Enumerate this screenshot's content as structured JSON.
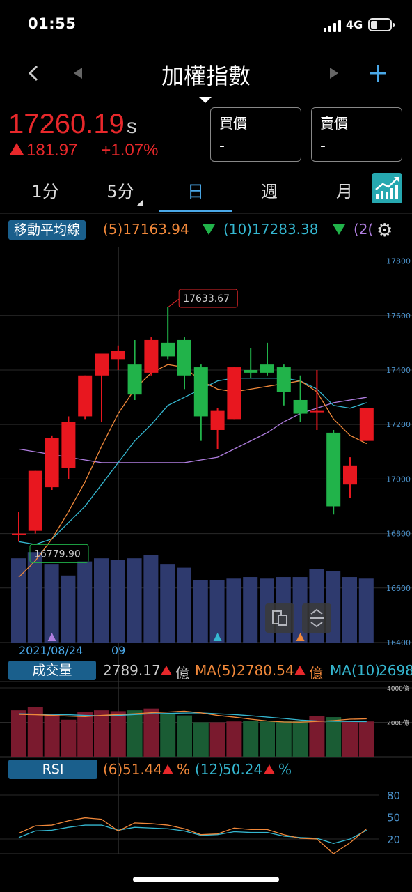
{
  "status": {
    "time": "01:55",
    "network": "4G"
  },
  "nav": {
    "title": "加權指數",
    "back": "‹",
    "add": "+"
  },
  "quote": {
    "price": "17260.19",
    "price_suffix": "s",
    "change": "181.97",
    "change_pct": "+1.07%",
    "bid_label": "買價",
    "bid_value": "-",
    "ask_label": "賣價",
    "ask_value": "-",
    "color_up": "#e8282b"
  },
  "tabs": [
    "1分",
    "5分",
    "日",
    "週",
    "月"
  ],
  "active_tab": "日",
  "ma_legend": {
    "label": "移動平均線",
    "ma5": "(5)17163.94",
    "ma10": "(10)17283.38",
    "ma20": "(2("
  },
  "price_axis": [
    "17800",
    "17600",
    "17400",
    "17200",
    "17000",
    "16800",
    "16600",
    "16400"
  ],
  "annotations": {
    "high": "17633.67",
    "low": "16779.90"
  },
  "date_labels": {
    "first": "2021/08/24",
    "second": "09"
  },
  "volume_legend": {
    "label": "成交量",
    "value": "2789.17",
    "unit": "億",
    "ma5_label": "MA(5)",
    "ma5": "2780.54",
    "ma5_unit": "億",
    "ma10_label": "MA(10)",
    "ma10": "2698"
  },
  "volume_axis": [
    "4000億",
    "2000億"
  ],
  "rsi_legend": {
    "label": "RSI",
    "rsi6_label": "(6)",
    "rsi6": "51.44",
    "rsi12_label": "(12)",
    "rsi12": "50.24",
    "unit": "%"
  },
  "rsi_axis": [
    "80",
    "50",
    "20"
  ],
  "colors": {
    "up": "#e8171f",
    "down": "#21b34a",
    "ma5": "#f0883a",
    "ma10": "#35b7d0",
    "ma20": "#b07ee0",
    "volbar": "#2e3a6e",
    "accent": "#4aa8e8"
  },
  "chart_data": {
    "type": "candlestick",
    "ylim": [
      16400,
      17850
    ],
    "candles": [
      {
        "o": 16800,
        "h": 16880,
        "l": 16770,
        "c": 16800
      },
      {
        "o": 16810,
        "h": 17030,
        "l": 16800,
        "c": 17030
      },
      {
        "o": 16970,
        "h": 17160,
        "l": 16960,
        "c": 17150
      },
      {
        "o": 17040,
        "h": 17230,
        "l": 17000,
        "c": 17210
      },
      {
        "o": 17230,
        "h": 17380,
        "l": 17220,
        "c": 17380
      },
      {
        "o": 17380,
        "h": 17460,
        "l": 17210,
        "c": 17460
      },
      {
        "o": 17440,
        "h": 17490,
        "l": 17400,
        "c": 17470
      },
      {
        "o": 17420,
        "h": 17510,
        "l": 17290,
        "c": 17310
      },
      {
        "o": 17390,
        "h": 17520,
        "l": 17380,
        "c": 17510
      },
      {
        "o": 17500,
        "h": 17630,
        "l": 17440,
        "c": 17450
      },
      {
        "o": 17510,
        "h": 17520,
        "l": 17330,
        "c": 17380
      },
      {
        "o": 17410,
        "h": 17420,
        "l": 17140,
        "c": 17230
      },
      {
        "o": 17180,
        "h": 17260,
        "l": 17110,
        "c": 17250
      },
      {
        "o": 17220,
        "h": 17410,
        "l": 17220,
        "c": 17410
      },
      {
        "o": 17400,
        "h": 17480,
        "l": 17370,
        "c": 17390
      },
      {
        "o": 17420,
        "h": 17500,
        "l": 17380,
        "c": 17390
      },
      {
        "o": 17410,
        "h": 17420,
        "l": 17270,
        "c": 17320
      },
      {
        "o": 17290,
        "h": 17380,
        "l": 17210,
        "c": 17240
      },
      {
        "o": 17250,
        "h": 17400,
        "l": 17180,
        "c": 17250
      },
      {
        "o": 17170,
        "h": 17180,
        "l": 16870,
        "c": 16900
      },
      {
        "o": 16980,
        "h": 17080,
        "l": 16930,
        "c": 17050
      },
      {
        "o": 17140,
        "h": 17230,
        "l": 17140,
        "c": 17260
      }
    ],
    "ma5": [
      16640,
      16700,
      16780,
      16880,
      16990,
      17120,
      17240,
      17330,
      17390,
      17420,
      17410,
      17360,
      17330,
      17320,
      17330,
      17340,
      17350,
      17360,
      17320,
      17220,
      17160,
      17130
    ],
    "ma10": [
      16770,
      16760,
      16780,
      16840,
      16900,
      16980,
      17060,
      17140,
      17200,
      17270,
      17300,
      17330,
      17360,
      17370,
      17370,
      17370,
      17370,
      17360,
      17330,
      17270,
      17260,
      17280
    ],
    "ma20": [
      17110,
      17100,
      17090,
      17080,
      17070,
      17060,
      17060,
      17060,
      17060,
      17060,
      17060,
      17070,
      17080,
      17110,
      17140,
      17170,
      17210,
      17240,
      17260,
      17280,
      17290,
      17300
    ],
    "volume": {
      "ylim": [
        0,
        4200
      ],
      "values": [
        2700,
        2900,
        2500,
        2150,
        2600,
        2700,
        2650,
        2700,
        2800,
        2500,
        2400,
        2000,
        2000,
        2050,
        2100,
        2050,
        2100,
        2100,
        2350,
        2300,
        2100,
        2050
      ],
      "ma5": [
        2460,
        2440,
        2400,
        2360,
        2330,
        2400,
        2450,
        2500,
        2560,
        2600,
        2650,
        2550,
        2400,
        2300,
        2180,
        2080,
        2020,
        2010,
        2050,
        2100,
        2180,
        2200
      ],
      "ma10": [
        2500,
        2480,
        2460,
        2440,
        2400,
        2380,
        2400,
        2450,
        2500,
        2520,
        2540,
        2550,
        2500,
        2450,
        2380,
        2300,
        2220,
        2130,
        2080,
        2060,
        2050,
        2040
      ]
    },
    "rsi": {
      "ylim": [
        0,
        100
      ],
      "rsi6": [
        28,
        38,
        39,
        45,
        49,
        47,
        31,
        42,
        41,
        39,
        34,
        26,
        27,
        35,
        33,
        33,
        26,
        21,
        20,
        0,
        15,
        34
      ],
      "rsi12": [
        22,
        31,
        32,
        36,
        39,
        39,
        32,
        36,
        35,
        34,
        31,
        25,
        26,
        30,
        29,
        29,
        24,
        22,
        21,
        14,
        20,
        32
      ]
    },
    "markers": [
      {
        "index": 2,
        "color": "#b07ee0"
      },
      {
        "index": 12,
        "color": "#35b7d0"
      },
      {
        "index": 17,
        "color": "#f0883a"
      }
    ]
  }
}
